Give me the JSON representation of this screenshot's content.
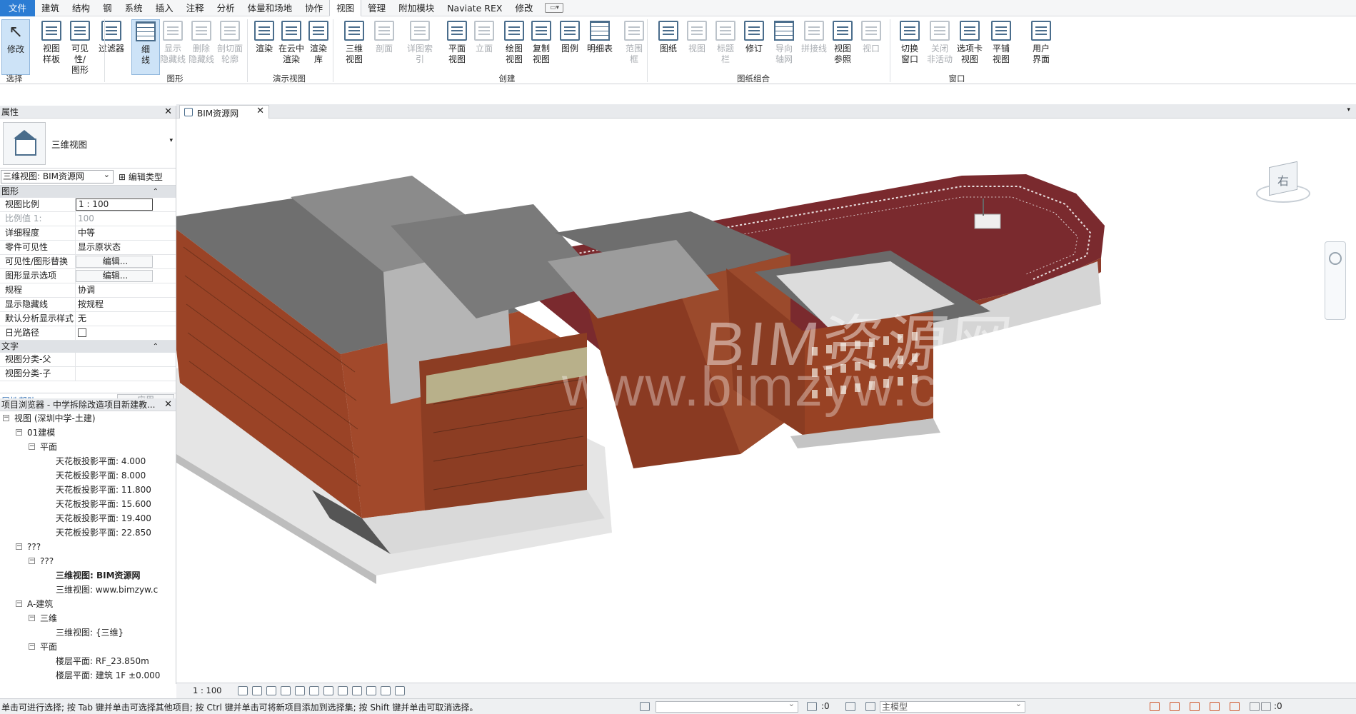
{
  "menubar": {
    "tabs": [
      "文件",
      "建筑",
      "结构",
      "钢",
      "系统",
      "插入",
      "注释",
      "分析",
      "体量和场地",
      "协作",
      "视图",
      "管理",
      "附加模块",
      "Naviate REX",
      "修改"
    ],
    "active_tab": "视图"
  },
  "ribbon": {
    "buttons": [
      {
        "label": "修改",
        "state": "selected"
      },
      {
        "label": "视图\n样板",
        "state": "enabled"
      },
      {
        "label": "可见性/\n图形",
        "state": "enabled"
      },
      {
        "label": "过滤器",
        "state": "enabled"
      },
      {
        "label": "细\n线",
        "state": "selected"
      },
      {
        "label": "显示\n隐藏线",
        "state": "disabled"
      },
      {
        "label": "删除\n隐藏线",
        "state": "disabled"
      },
      {
        "label": "剖切面\n轮廓",
        "state": "disabled"
      },
      {
        "label": "渲染",
        "state": "enabled"
      },
      {
        "label": "在云中\n渲染",
        "state": "enabled"
      },
      {
        "label": "渲染\n库",
        "state": "enabled"
      },
      {
        "label": "三维\n视图",
        "state": "enabled"
      },
      {
        "label": "剖面",
        "state": "disabled"
      },
      {
        "label": "详图索引",
        "state": "disabled"
      },
      {
        "label": "平面\n视图",
        "state": "enabled"
      },
      {
        "label": "立面",
        "state": "disabled"
      },
      {
        "label": "绘图\n视图",
        "state": "enabled"
      },
      {
        "label": "复制\n视图",
        "state": "enabled"
      },
      {
        "label": "图例",
        "state": "enabled"
      },
      {
        "label": "明细表",
        "state": "enabled"
      },
      {
        "label": "范围\n框",
        "state": "disabled"
      },
      {
        "label": "图纸",
        "state": "enabled"
      },
      {
        "label": "视图",
        "state": "disabled"
      },
      {
        "label": "标题\n栏",
        "state": "disabled"
      },
      {
        "label": "修订",
        "state": "enabled"
      },
      {
        "label": "导向\n轴网",
        "state": "disabled"
      },
      {
        "label": "拼接线",
        "state": "disabled"
      },
      {
        "label": "视图\n参照",
        "state": "enabled"
      },
      {
        "label": "视口",
        "state": "disabled"
      },
      {
        "label": "切换\n窗口",
        "state": "enabled"
      },
      {
        "label": "关闭\n非活动",
        "state": "disabled"
      },
      {
        "label": "选项卡\n视图",
        "state": "enabled"
      },
      {
        "label": "平铺\n视图",
        "state": "enabled"
      },
      {
        "label": "用户\n界面",
        "state": "enabled"
      }
    ],
    "groups": [
      "选择",
      "图形",
      "演示视图",
      "创建",
      "图纸组合",
      "窗口"
    ]
  },
  "properties": {
    "title": "属性",
    "type_name": "三维视图",
    "view_selector": "三维视图: BIM资源网",
    "edit_type": "编辑类型",
    "sections": [
      {
        "name": "图形",
        "rows": [
          {
            "key": "视图比例",
            "value": "1 : 100",
            "kind": "box"
          },
          {
            "key": "比例值 1:",
            "value": "100",
            "kind": "dim"
          },
          {
            "key": "详细程度",
            "value": "中等",
            "kind": "text"
          },
          {
            "key": "零件可见性",
            "value": "显示原状态",
            "kind": "text"
          },
          {
            "key": "可见性/图形替换",
            "value": "编辑...",
            "kind": "btn"
          },
          {
            "key": "图形显示选项",
            "value": "编辑...",
            "kind": "btn"
          },
          {
            "key": "规程",
            "value": "协调",
            "kind": "text"
          },
          {
            "key": "显示隐藏线",
            "value": "按规程",
            "kind": "text"
          },
          {
            "key": "默认分析显示样式",
            "value": "无",
            "kind": "text"
          },
          {
            "key": "日光路径",
            "value": "",
            "kind": "check"
          }
        ]
      },
      {
        "name": "文字",
        "rows": [
          {
            "key": "视图分类-父",
            "value": "",
            "kind": "text"
          },
          {
            "key": "视图分类-子",
            "value": "",
            "kind": "text"
          }
        ]
      }
    ],
    "help_link": "属性帮助",
    "apply_label": "应用"
  },
  "browser": {
    "title": "项目浏览器 - 中学拆除改造项目新建教...",
    "nodes": [
      {
        "label": "视图 (深圳中学-土建)",
        "level": 0,
        "toggle": "⊟",
        "bold": false
      },
      {
        "label": "01建模",
        "level": 1,
        "toggle": "⊟",
        "bold": false
      },
      {
        "label": "平面",
        "level": 2,
        "toggle": "⊟",
        "bold": false
      },
      {
        "label": "天花板投影平面: 4.000",
        "level": 3,
        "toggle": "",
        "bold": false
      },
      {
        "label": "天花板投影平面: 8.000",
        "level": 3,
        "toggle": "",
        "bold": false
      },
      {
        "label": "天花板投影平面: 11.800",
        "level": 3,
        "toggle": "",
        "bold": false
      },
      {
        "label": "天花板投影平面: 15.600",
        "level": 3,
        "toggle": "",
        "bold": false
      },
      {
        "label": "天花板投影平面: 19.400",
        "level": 3,
        "toggle": "",
        "bold": false
      },
      {
        "label": "天花板投影平面: 22.850",
        "level": 3,
        "toggle": "",
        "bold": false
      },
      {
        "label": "???",
        "level": 1,
        "toggle": "⊟",
        "bold": false
      },
      {
        "label": "???",
        "level": 2,
        "toggle": "⊟",
        "bold": false
      },
      {
        "label": "三维视图: BIM资源网",
        "level": 3,
        "toggle": "",
        "bold": true
      },
      {
        "label": "三维视图: www.bimzyw.c",
        "level": 3,
        "toggle": "",
        "bold": false
      },
      {
        "label": "A-建筑",
        "level": 1,
        "toggle": "⊟",
        "bold": false
      },
      {
        "label": "三维",
        "level": 2,
        "toggle": "⊟",
        "bold": false
      },
      {
        "label": "三维视图: {三维}",
        "level": 3,
        "toggle": "",
        "bold": false
      },
      {
        "label": "平面",
        "level": 2,
        "toggle": "⊟",
        "bold": false
      },
      {
        "label": "楼层平面: RF_23.850m",
        "level": 3,
        "toggle": "",
        "bold": false
      },
      {
        "label": "楼层平面: 建筑 1F ±0.000",
        "level": 3,
        "toggle": "",
        "bold": false
      }
    ]
  },
  "viewtab": {
    "label": "BIM资源网"
  },
  "canvas": {
    "watermark_top": "BIM资源网",
    "watermark_bottom": "www.bimzyw.com",
    "viewcube_label": "右"
  },
  "viewctl": {
    "scale": "1 : 100"
  },
  "statusbar": {
    "message": "单击可进行选择; 按 Tab 键并单击可选择其他项目; 按 Ctrl 键并单击可将新项目添加到选择集; 按 Shift 键并单击可取消选择。",
    "worksets_count": ":0",
    "model_dropdown": "主模型",
    "filter_count": ":0"
  },
  "colors": {
    "accent": "#2b7cd3",
    "brick": "#9a4326",
    "track": "#7a2a2e",
    "roof": "#6f6f6f"
  }
}
